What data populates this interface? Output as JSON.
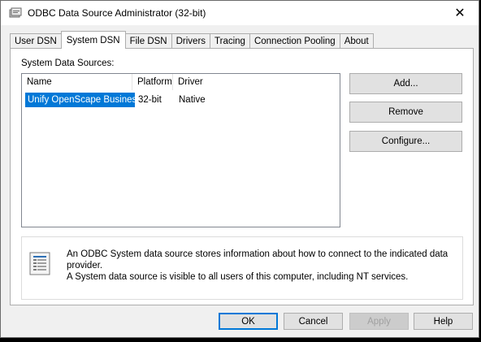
{
  "window": {
    "title": "ODBC Data Source Administrator (32-bit)",
    "close_glyph": "✕"
  },
  "tabs": [
    {
      "label": "User DSN",
      "active": false
    },
    {
      "label": "System DSN",
      "active": true
    },
    {
      "label": "File DSN",
      "active": false
    },
    {
      "label": "Drivers",
      "active": false
    },
    {
      "label": "Tracing",
      "active": false
    },
    {
      "label": "Connection Pooling",
      "active": false
    },
    {
      "label": "About",
      "active": false
    }
  ],
  "system_dsn": {
    "section_label": "System Data Sources:",
    "columns": [
      "Name",
      "Platform",
      "Driver"
    ],
    "rows": [
      {
        "name": "Unify OpenScape Business",
        "platform": "32-bit",
        "driver": "Native",
        "selected": true
      }
    ],
    "buttons": {
      "add": "Add...",
      "remove": "Remove",
      "configure": "Configure..."
    },
    "info_line1": "An ODBC System data source stores information about how to connect to the indicated data provider.",
    "info_line2": "A System data source is visible to all users of this computer, including NT services."
  },
  "footer": {
    "ok": "OK",
    "cancel": "Cancel",
    "apply": "Apply",
    "help": "Help"
  },
  "colors": {
    "selection": "#0078d7",
    "button_face": "#e1e1e1",
    "panel_bg": "#ffffff",
    "window_bg": "#f0f0f0"
  }
}
